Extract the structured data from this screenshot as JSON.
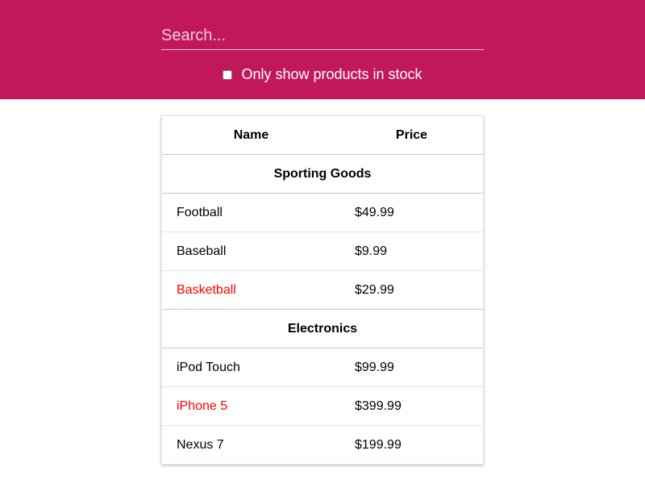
{
  "search": {
    "placeholder": "Search...",
    "value": ""
  },
  "stock_filter": {
    "label": "Only show products in stock",
    "checked": false
  },
  "table": {
    "headers": {
      "name": "Name",
      "price": "Price"
    },
    "categories": [
      {
        "label": "Sporting Goods",
        "products": [
          {
            "name": "Football",
            "price": "$49.99",
            "in_stock": true
          },
          {
            "name": "Baseball",
            "price": "$9.99",
            "in_stock": true
          },
          {
            "name": "Basketball",
            "price": "$29.99",
            "in_stock": false
          }
        ]
      },
      {
        "label": "Electronics",
        "products": [
          {
            "name": "iPod Touch",
            "price": "$99.99",
            "in_stock": true
          },
          {
            "name": "iPhone 5",
            "price": "$399.99",
            "in_stock": false
          },
          {
            "name": "Nexus 7",
            "price": "$199.99",
            "in_stock": true
          }
        ]
      }
    ]
  },
  "colors": {
    "header_bg": "#c2185b",
    "out_of_stock_text": "#ff0000"
  }
}
